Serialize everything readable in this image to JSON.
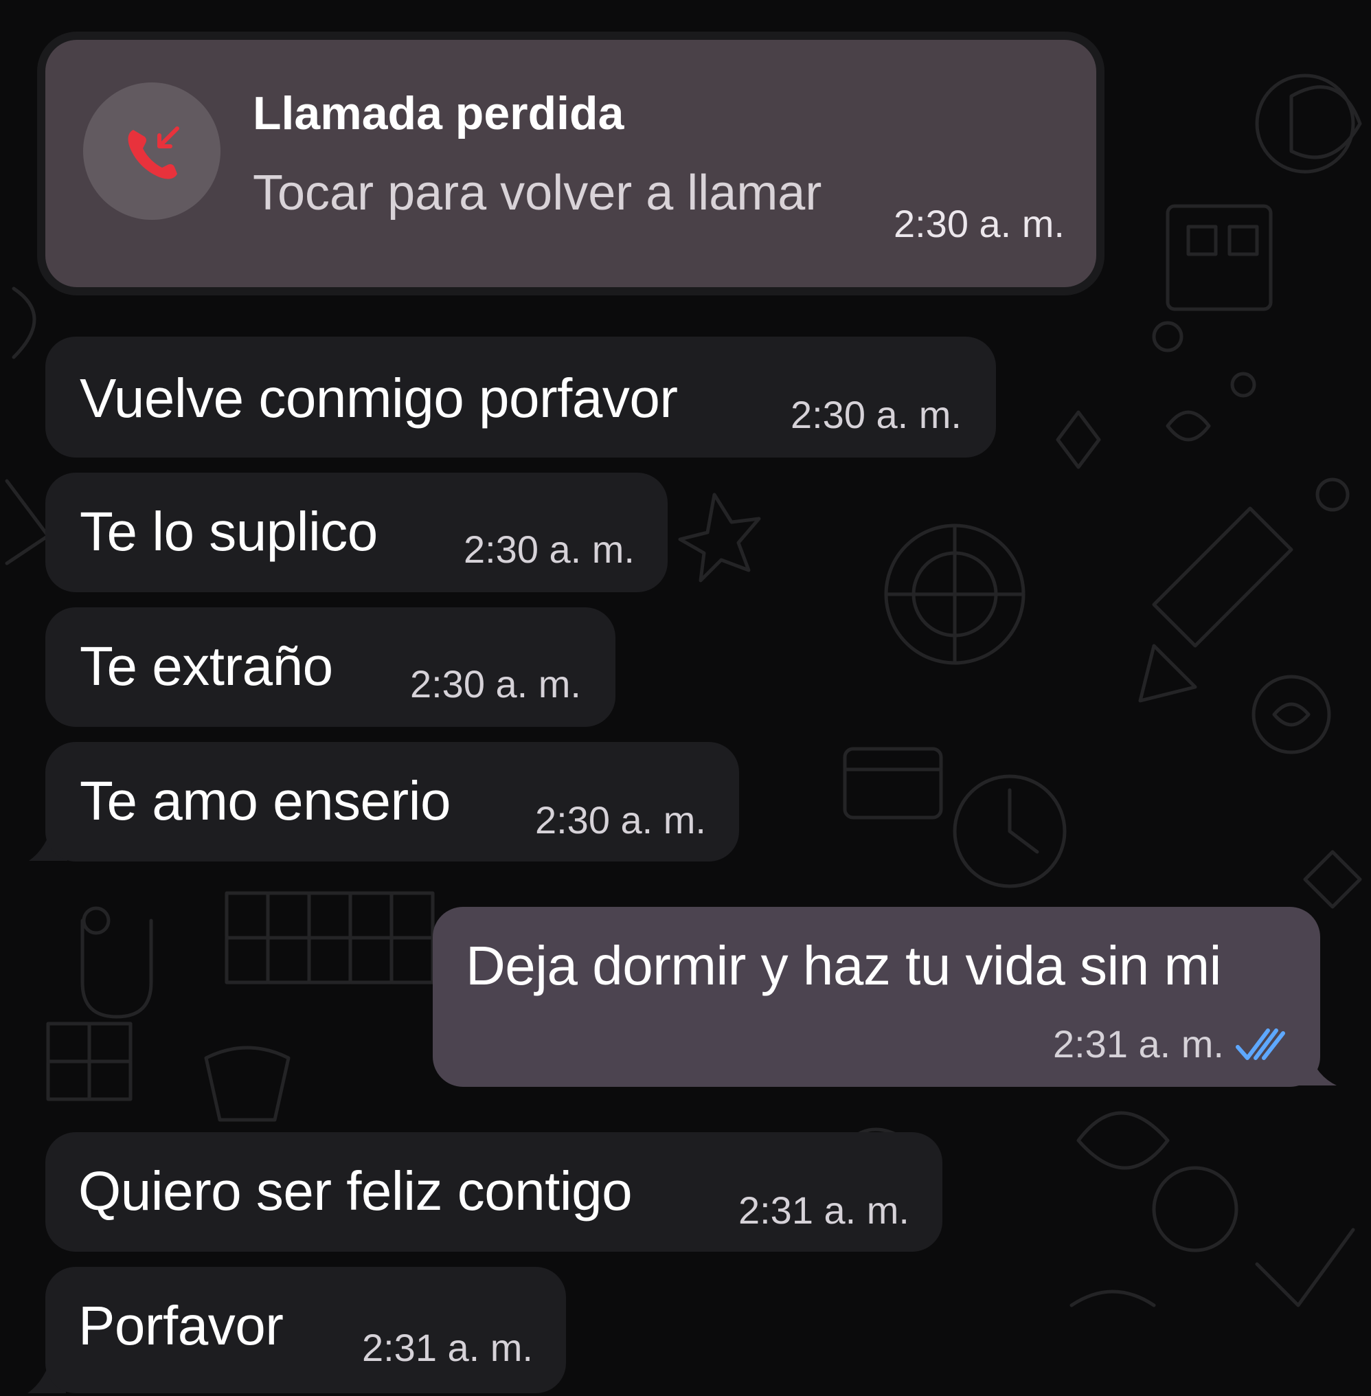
{
  "missed_call": {
    "title": "Llamada perdida",
    "subtitle": "Tocar para volver a llamar",
    "time": "2:30 a. m.",
    "icon": "missed-call-icon",
    "icon_color": "#e8323c"
  },
  "messages": [
    {
      "direction": "incoming",
      "text": "Vuelve conmigo porfavor",
      "time": "2:30 a. m."
    },
    {
      "direction": "incoming",
      "text": "Te lo suplico",
      "time": "2:30 a. m."
    },
    {
      "direction": "incoming",
      "text": "Te extraño",
      "time": "2:30 a. m."
    },
    {
      "direction": "incoming",
      "text": "Te amo enserio",
      "time": "2:30 a. m."
    },
    {
      "direction": "outgoing",
      "text": "Deja dormir y haz tu vida sin mi",
      "time": "2:31 a. m.",
      "status": "read",
      "status_icon": "double-check-icon",
      "status_color": "#5ea8ff"
    },
    {
      "direction": "incoming",
      "text": "Quiero ser feliz contigo",
      "time": "2:31 a. m."
    },
    {
      "direction": "incoming",
      "text": "Porfavor",
      "time": "2:31 a. m."
    }
  ],
  "colors": {
    "background": "#0b0b0c",
    "incoming_bubble": "#1d1d20",
    "outgoing_bubble": "#4c4450",
    "call_card": "#4a4148"
  }
}
